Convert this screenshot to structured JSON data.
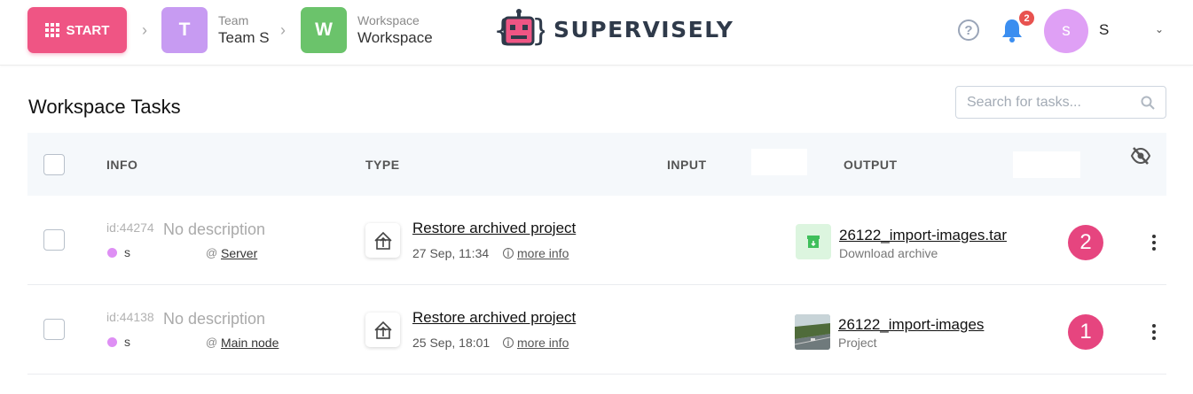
{
  "header": {
    "start_label": "START",
    "team": {
      "initial": "T",
      "key": "Team",
      "value": "Team S",
      "color": "#c79bf2"
    },
    "workspace": {
      "initial": "W",
      "key": "Workspace",
      "value": "Workspace",
      "color": "#6bc36b"
    },
    "logo_text": "SUPERVISELY",
    "notifications_count": "2",
    "user": {
      "initial": "s",
      "name": "S"
    }
  },
  "page": {
    "title": "Workspace Tasks",
    "search_placeholder": "Search for tasks..."
  },
  "table": {
    "columns": {
      "info": "INFO",
      "type": "TYPE",
      "input": "INPUT",
      "output": "OUTPUT"
    },
    "rows": [
      {
        "id": "id:44274",
        "description": "No description",
        "user": "s",
        "at": "@",
        "node": "Server",
        "type_name": "Restore archived project",
        "date": "27 Sep, 11:34",
        "more_info": "more info",
        "output_name": "26122_import-images.tar",
        "output_sub": "Download archive",
        "output_icon": "download-archive-icon",
        "badge": "2"
      },
      {
        "id": "id:44138",
        "description": "No description",
        "user": "s",
        "at": "@",
        "node": "Main node",
        "type_name": "Restore archived project",
        "date": "25 Sep, 18:01",
        "more_info": "more info",
        "output_name": "26122_import-images",
        "output_sub": "Project",
        "output_icon": "project-thumbnail",
        "badge": "1"
      }
    ]
  },
  "colors": {
    "accent": "#ef5584",
    "badge": "#e6457f",
    "user_dot": "#de8ff4"
  }
}
